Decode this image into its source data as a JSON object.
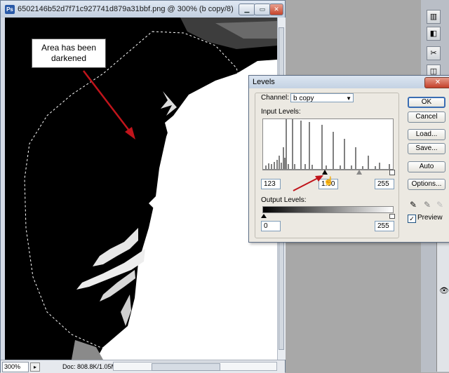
{
  "document": {
    "title": "6502146b52d7f71c927741d879a31bbf.png @ 300% (b copy/8)",
    "icon_letters": "Ps",
    "zoom": "300%",
    "info": "Doc: 808.8K/1.05M"
  },
  "annotation": {
    "callout_line1": "Area has been",
    "callout_line2": "darkened",
    "arrow_color": "#c0141b"
  },
  "levels": {
    "title": "Levels",
    "channel_label": "Channel:",
    "channel_value": "b copy",
    "input_levels_label": "Input Levels:",
    "input_black": "123",
    "input_gamma": "1.00",
    "input_white": "255",
    "output_levels_label": "Output Levels:",
    "output_black": "0",
    "output_white": "255",
    "buttons": {
      "ok": "OK",
      "cancel": "Cancel",
      "load": "Load...",
      "save": "Save...",
      "auto": "Auto",
      "options": "Options..."
    },
    "preview_label": "Preview",
    "preview_checked": "✓"
  }
}
